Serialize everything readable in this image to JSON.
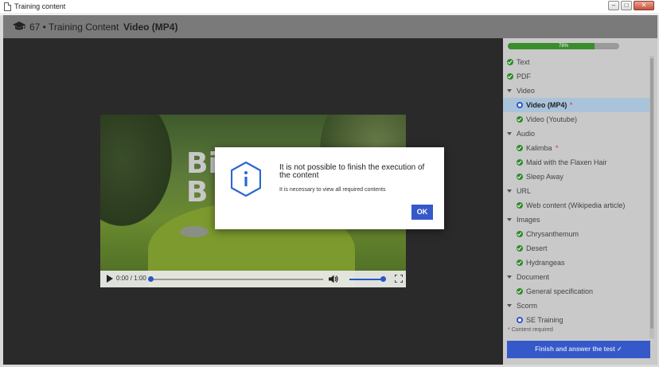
{
  "window": {
    "title": "Training content",
    "buttons": [
      "minimize",
      "maximize",
      "close"
    ]
  },
  "header": {
    "crumb": "67 • Training Content",
    "separator": "›",
    "current": "Video (MP4)",
    "icon": "graduation-cap-icon"
  },
  "video": {
    "title_overlay": "Bi\nB",
    "time": "0:00 / 1:00",
    "progress_fraction": 0.0,
    "volume_fraction": 1.0
  },
  "modal": {
    "title": "It is not possible to finish the execution of the content",
    "subtitle": "It is necessary to view all required contents",
    "ok_label": "OK",
    "icon": "info-icon"
  },
  "sidebar": {
    "progress_percent": 78,
    "progress_label": "78%",
    "items": [
      {
        "label": "Text",
        "type": "item",
        "level": 1,
        "status": "complete"
      },
      {
        "label": "PDF",
        "type": "item",
        "level": 1,
        "status": "complete"
      },
      {
        "label": "Video",
        "type": "group",
        "level": 1
      },
      {
        "label": "Video (MP4)",
        "type": "item",
        "level": 2,
        "status": "current",
        "required": true,
        "active": true
      },
      {
        "label": "Video (Youtube)",
        "type": "item",
        "level": 2,
        "status": "complete"
      },
      {
        "label": "Audio",
        "type": "group",
        "level": 1
      },
      {
        "label": "Kalimba",
        "type": "item",
        "level": 2,
        "status": "complete",
        "required": true
      },
      {
        "label": "Maid with the Flaxen Hair",
        "type": "item",
        "level": 2,
        "status": "complete"
      },
      {
        "label": "Sleep Away",
        "type": "item",
        "level": 2,
        "status": "complete"
      },
      {
        "label": "URL",
        "type": "group",
        "level": 1
      },
      {
        "label": "Web content (Wikipedia article)",
        "type": "item",
        "level": 2,
        "status": "complete"
      },
      {
        "label": "Images",
        "type": "group",
        "level": 1
      },
      {
        "label": "Chrysanthemum",
        "type": "item",
        "level": 2,
        "status": "complete"
      },
      {
        "label": "Desert",
        "type": "item",
        "level": 2,
        "status": "complete"
      },
      {
        "label": "Hydrangeas",
        "type": "item",
        "level": 2,
        "status": "complete"
      },
      {
        "label": "Document",
        "type": "group",
        "level": 1
      },
      {
        "label": "General specification",
        "type": "item",
        "level": 2,
        "status": "complete"
      },
      {
        "label": "Scorm",
        "type": "group",
        "level": 1
      },
      {
        "label": "SE Training",
        "type": "item",
        "level": 2,
        "status": "current"
      }
    ],
    "required_note": "Content required",
    "required_star": "*",
    "finish_label": "Finish and answer the test",
    "finish_icon": "check-icon"
  },
  "colors": {
    "accent": "#3659c9",
    "complete": "#2d8a2d",
    "required": "#d03030",
    "active_row": "#a9c3da"
  }
}
